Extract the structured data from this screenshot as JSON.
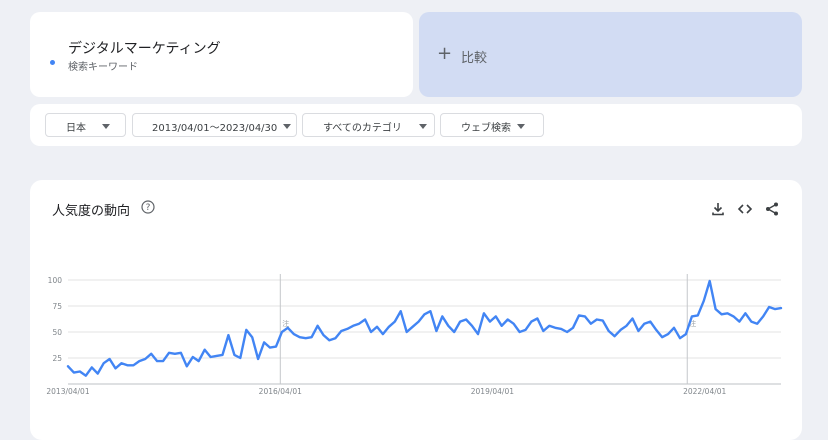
{
  "term": {
    "title": "デジタルマーケティング",
    "subtitle": "検索キーワード",
    "dot_color": "#4285f4"
  },
  "compare": {
    "plus": "+",
    "label": "比較"
  },
  "filters": {
    "region": "日本",
    "date_range": "2013/04/01〜2023/04/30",
    "category": "すべてのカテゴリ",
    "search_type": "ウェブ検索"
  },
  "chart_header": {
    "title": "人気度の動向",
    "help_icon": "help-circle-icon",
    "download_icon": "download-icon",
    "embed_icon": "embed-code-icon",
    "share_icon": "share-icon"
  },
  "chart_data": {
    "type": "line",
    "x_start": "2013/04/01",
    "x_end": "2023/04/30",
    "ylim": [
      0,
      100
    ],
    "yticks": [
      25,
      50,
      75,
      100
    ],
    "xticks": [
      "2013/04/01",
      "2016/04/01",
      "2019/04/01",
      "2022/04/01"
    ],
    "line_color": "#4285f4",
    "grid": true,
    "note_markers": [
      {
        "date": "2016/04/01",
        "label": "注"
      },
      {
        "date": "2022/01/01",
        "label": "注"
      }
    ],
    "series": [
      {
        "values": [
          17,
          11,
          12,
          8,
          16,
          10,
          20,
          24,
          15,
          20,
          18,
          18,
          22,
          24,
          29,
          22,
          22,
          30,
          29,
          30,
          17,
          26,
          22,
          33,
          26,
          27,
          28,
          47,
          28,
          25,
          52,
          45,
          24,
          40,
          35,
          36,
          50,
          54,
          48,
          45,
          44,
          45,
          56,
          47,
          42,
          44,
          51,
          53,
          56,
          58,
          62,
          50,
          55,
          48,
          55,
          60,
          70,
          50,
          55,
          60,
          67,
          70,
          51,
          65,
          56,
          50,
          60,
          62,
          56,
          48,
          68,
          60,
          65,
          56,
          62,
          58,
          50,
          52,
          60,
          63,
          51,
          56,
          54,
          53,
          50,
          54,
          66,
          65,
          58,
          62,
          61,
          51,
          46,
          52,
          56,
          63,
          51,
          58,
          60,
          52,
          45,
          48,
          54,
          44,
          48,
          65,
          66,
          80,
          99,
          72,
          67,
          68,
          65,
          60,
          68,
          60,
          58,
          65,
          74,
          72,
          73
        ]
      }
    ]
  }
}
